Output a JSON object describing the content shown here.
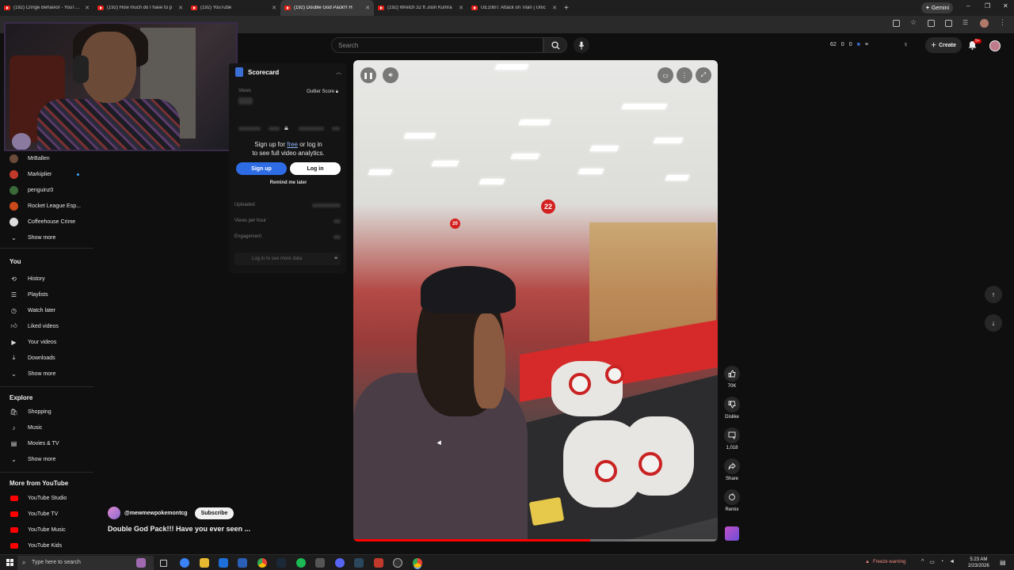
{
  "browser": {
    "tabs": [
      {
        "label": "(192) Cringe Behavior - YouTube",
        "active": false
      },
      {
        "label": "(192) How much do I have to p",
        "active": false
      },
      {
        "label": "(192) YouTube",
        "active": false
      },
      {
        "label": "(192) Double God Pack!!! H",
        "active": true
      },
      {
        "label": "(192) Wretch 32 ft Josh Kumra",
        "active": false
      },
      {
        "label": "UE10BT: Attack on Titan | Unic",
        "active": false
      }
    ],
    "gemini_label": "Gemini"
  },
  "header": {
    "search_placeholder": "Search",
    "ext_stats": [
      "62",
      "0",
      "0"
    ],
    "create_label": "Create",
    "notification_badge": "9+"
  },
  "sidebar": {
    "subscriptions": [
      {
        "label": "MrBallen",
        "color": "#6a4a3a",
        "new": false
      },
      {
        "label": "Markiplier",
        "color": "#c0392b",
        "new": true
      },
      {
        "label": "penguinz0",
        "color": "#3a6a3a",
        "new": false
      },
      {
        "label": "Rocket League Esp...",
        "color": "#c84a1a",
        "new": false
      },
      {
        "label": "Coffeehouse Crime",
        "color": "#dddddd",
        "new": false
      },
      {
        "label": "Show more",
        "color": "",
        "new": false
      }
    ],
    "you_heading": "You",
    "you_items": [
      "History",
      "Playlists",
      "Watch later",
      "Liked videos",
      "Your videos",
      "Downloads",
      "Show more"
    ],
    "explore_heading": "Explore",
    "explore_items": [
      "Shopping",
      "Music",
      "Movies & TV",
      "Show more"
    ],
    "more_heading": "More from YouTube",
    "more_items": [
      "YouTube Studio",
      "YouTube TV",
      "YouTube Music",
      "YouTube Kids"
    ]
  },
  "scorecard": {
    "title": "Scorecard",
    "views_label": "Views",
    "outlier_label": "Outlier Score",
    "signup_line1_pre": "Sign up for ",
    "signup_free": "free",
    "signup_line1_post": " or log in",
    "signup_line2": "to see full video analytics.",
    "signup_button": "Sign up",
    "login_button": "Log in",
    "remind_label": "Remind me later",
    "rows": [
      "Uploaded",
      "Views per hour",
      "Engagement"
    ],
    "footer_label": "Log in to see more data"
  },
  "video": {
    "progress_fraction": 0.65,
    "sign_numbers": [
      "22",
      "20"
    ],
    "channel_name": "@mewmewpokemontcg",
    "subscribe_label": "Subscribe",
    "title": "Double God Pack!!! Have you ever seen ..."
  },
  "actions": {
    "likes": "70K",
    "dislike": "Dislike",
    "comments": "1,018",
    "share": "Share",
    "remix": "Remix"
  },
  "taskbar": {
    "search_placeholder": "Type here to search",
    "freeze_warning": "Freeze warning",
    "time": "5:23 AM",
    "date": "2/23/2026"
  }
}
